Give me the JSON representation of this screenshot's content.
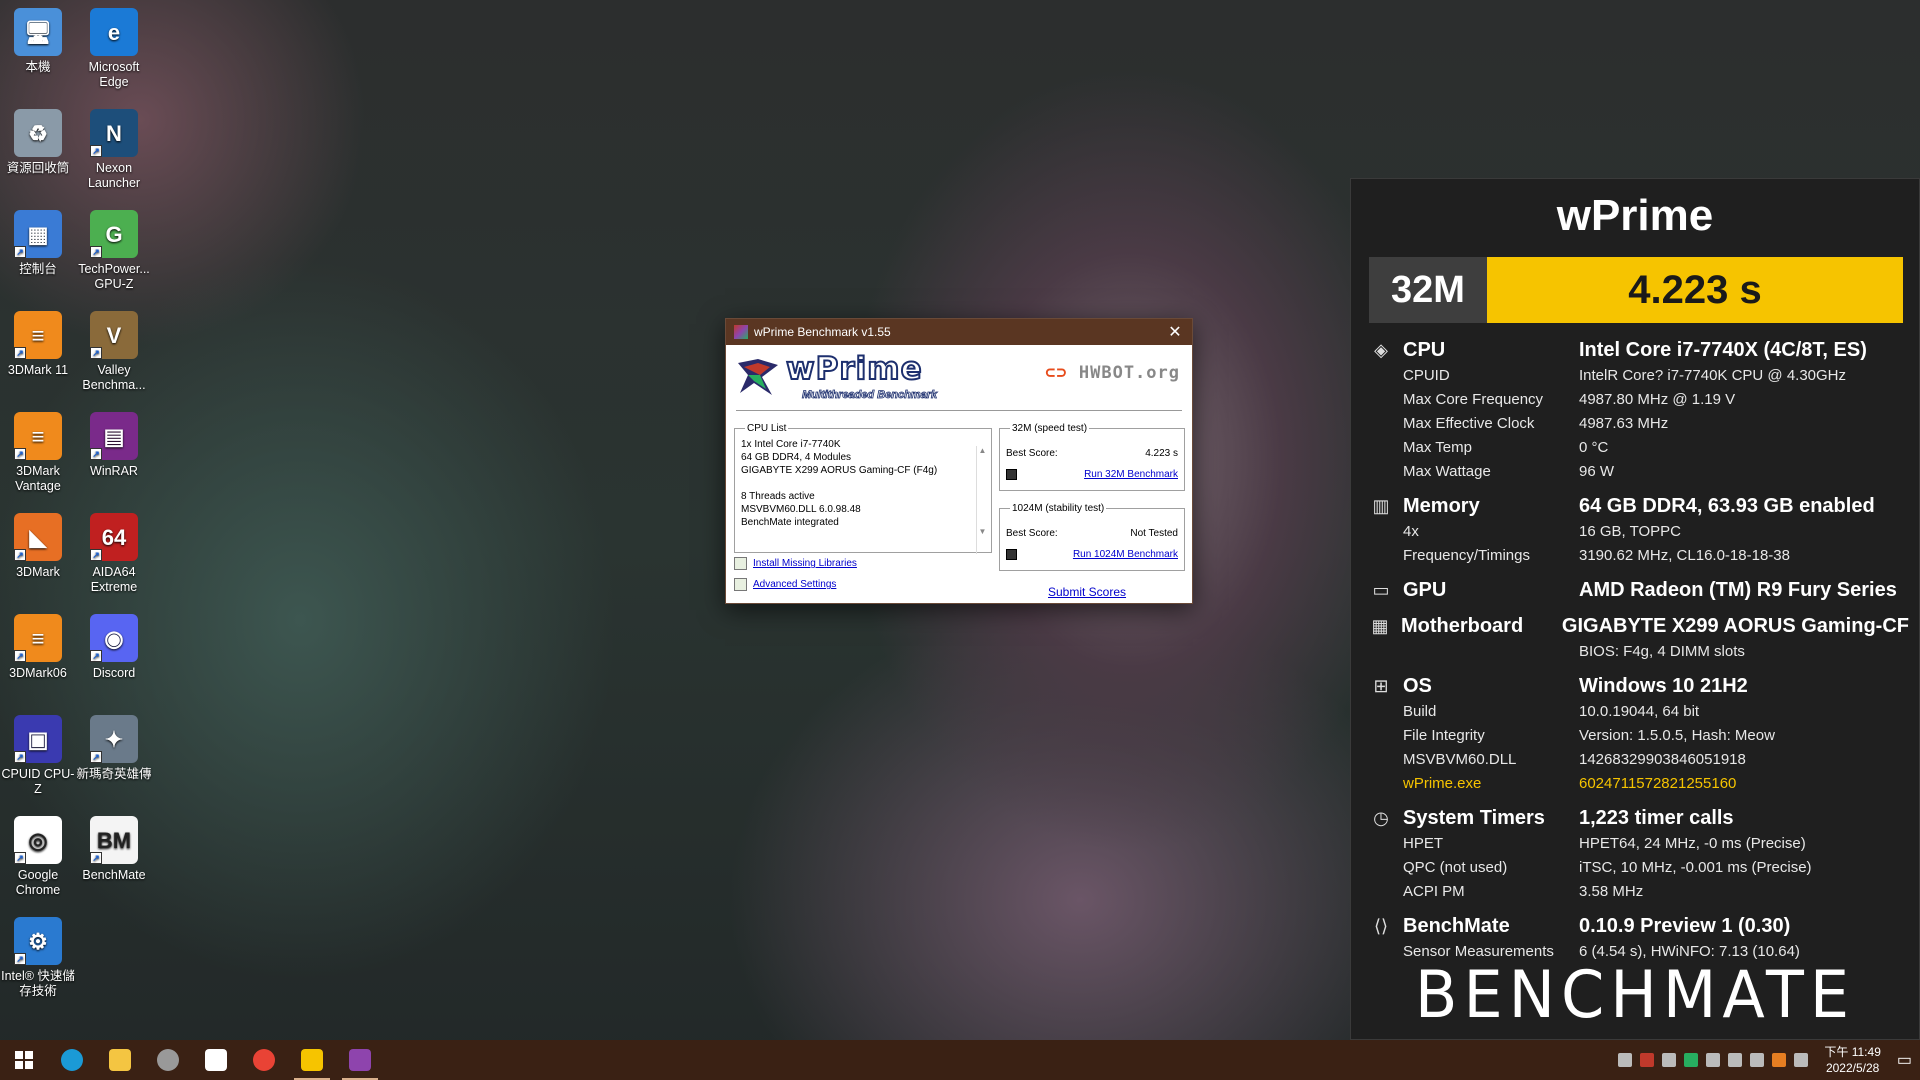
{
  "desktop": {
    "icons": [
      {
        "label": "本機",
        "icon": "computer-icon"
      },
      {
        "label": "Microsoft Edge",
        "icon": "edge-icon"
      },
      {
        "label": "資源回收筒",
        "icon": "recycle-bin-icon"
      },
      {
        "label": "Nexon Launcher",
        "icon": "nexon-icon"
      },
      {
        "label": "控制台",
        "icon": "control-panel-icon"
      },
      {
        "label": "TechPower... GPU-Z",
        "icon": "gpuz-icon"
      },
      {
        "label": "3DMark 11",
        "icon": "3dmark11-icon"
      },
      {
        "label": "Valley Benchma...",
        "icon": "valley-icon"
      },
      {
        "label": "3DMark Vantage",
        "icon": "3dmark-vantage-icon"
      },
      {
        "label": "WinRAR",
        "icon": "winrar-icon"
      },
      {
        "label": "3DMark",
        "icon": "3dmark-icon"
      },
      {
        "label": "AIDA64 Extreme",
        "icon": "aida64-icon"
      },
      {
        "label": "3DMark06",
        "icon": "3dmark06-icon"
      },
      {
        "label": "Discord",
        "icon": "discord-icon"
      },
      {
        "label": "CPUID CPU-Z",
        "icon": "cpuz-icon"
      },
      {
        "label": "新瑪奇英雄傳",
        "icon": "game-icon"
      },
      {
        "label": "Google Chrome",
        "icon": "chrome-icon"
      },
      {
        "label": "BenchMate",
        "icon": "benchmate-icon"
      },
      {
        "label": "Intel® 快速儲存技術",
        "icon": "intel-rst-icon"
      }
    ],
    "icon_glyphs": [
      "🖥",
      "e",
      "♻",
      "N",
      "▦",
      "G",
      "≡",
      "V",
      "≡",
      "▤",
      "◣",
      "64",
      "≡",
      "◉",
      "▣",
      "✦",
      "◎",
      "BM",
      "⚙"
    ],
    "icon_colors": [
      "#4a90d9",
      "#1b7ad6",
      "#8a9aa8",
      "#1d4e7a",
      "#3a7bd5",
      "#4caf50",
      "#f08a1c",
      "#8a6a3a",
      "#f08a1c",
      "#7a2a8a",
      "#e76f24",
      "#c02020",
      "#f08a1c",
      "#5865f2",
      "#3a3ab0",
      "#6a7a8a",
      "#ffffff",
      "#f4f4f4",
      "#2a7ad0"
    ]
  },
  "wprime_window": {
    "title": "wPrime Benchmark v1.55",
    "close_glyph": "✕",
    "logo": "wPrime",
    "logo_sub": "Multithreaded Benchmark",
    "hwbot": "HWBOT.org",
    "cpu_list": {
      "legend": "CPU List",
      "lines": [
        "1x Intel Core i7-7740K",
        "64 GB DDR4, 4 Modules",
        "GIGABYTE X299 AORUS Gaming-CF (F4g)",
        "",
        "8 Threads active",
        "MSVBVM60.DLL 6.0.98.48",
        "BenchMate integrated"
      ]
    },
    "test32": {
      "legend": "32M (speed test)",
      "best_label": "Best Score:",
      "best_value": "4.223 s",
      "run_label": "Run 32M Benchmark"
    },
    "test1024": {
      "legend": "1024M (stability test)",
      "best_label": "Best Score:",
      "best_value": "Not Tested",
      "run_label": "Run 1024M Benchmark"
    },
    "install_label": "Install Missing Libraries",
    "advanced_label": "Advanced Settings",
    "submit_label": "Submit Scores"
  },
  "benchmate": {
    "title": "wPrime",
    "score_label": "32M",
    "score_value": "4.223 s",
    "accent": "#f6c400",
    "sections": [
      {
        "icon": "cpu-icon",
        "glyph": "◈",
        "name": "CPU",
        "value": "Intel Core i7-7740X (4C/8T, ES)",
        "rows": [
          {
            "k": "CPUID",
            "v": "IntelR Core? i7-7740K CPU @ 4.30GHz"
          },
          {
            "k": "Max Core Frequency",
            "v": "4987.80 MHz @ 1.19 V"
          },
          {
            "k": "Max Effective Clock",
            "v": "4987.63 MHz"
          },
          {
            "k": "Max Temp",
            "v": "0 °C"
          },
          {
            "k": "Max Wattage",
            "v": "96 W"
          }
        ]
      },
      {
        "icon": "memory-icon",
        "glyph": "▥",
        "name": "Memory",
        "value": "64 GB DDR4, 63.93 GB enabled",
        "rows": [
          {
            "k": "4x",
            "v": "16 GB, TOPPC"
          },
          {
            "k": "Frequency/Timings",
            "v": "3190.62 MHz, CL16.0-18-18-38"
          }
        ]
      },
      {
        "icon": "gpu-icon",
        "glyph": "▭",
        "name": "GPU",
        "value": "AMD Radeon (TM) R9 Fury Series",
        "rows": []
      },
      {
        "icon": "motherboard-icon",
        "glyph": "▦",
        "name": "Motherboard",
        "value": "GIGABYTE X299 AORUS Gaming-CF",
        "rows": [
          {
            "k": "",
            "v": "BIOS: F4g, 4 DIMM slots"
          }
        ]
      },
      {
        "icon": "windows-icon",
        "glyph": "⊞",
        "name": "OS",
        "value": "Windows 10 21H2",
        "rows": [
          {
            "k": "Build",
            "v": "10.0.19044, 64 bit"
          },
          {
            "k": "File Integrity",
            "v": "Version: 1.5.0.5, Hash: Meow"
          },
          {
            "k": "MSVBVM60.DLL",
            "v": "14268329903846051918"
          },
          {
            "k": "wPrime.exe",
            "v": "6024711572821255160",
            "hl": true
          }
        ]
      },
      {
        "icon": "timer-icon",
        "glyph": "◷",
        "name": "System Timers",
        "value": "1,223 timer calls",
        "rows": [
          {
            "k": "HPET",
            "v": "HPET64, 24 MHz, -0 ms (Precise)"
          },
          {
            "k": "QPC (not used)",
            "v": "iTSC, 10 MHz, -0.001 ms (Precise)"
          },
          {
            "k": "ACPI PM",
            "v": "3.58 MHz"
          }
        ]
      },
      {
        "icon": "benchmate-icon",
        "glyph": "⟨⟩",
        "name": "BenchMate",
        "value": "0.10.9 Preview 1 (0.30)",
        "rows": [
          {
            "k": "Sensor Measurements",
            "v": "6 (4.54 s), HWiNFO: 7.13 (10.64)"
          }
        ]
      }
    ],
    "footer_logo": "BENCHMATE"
  },
  "taskbar": {
    "items": [
      {
        "icon": "start-icon",
        "color": "#ffffff"
      },
      {
        "icon": "edge-icon",
        "color": "#1b9ad6"
      },
      {
        "icon": "explorer-icon",
        "color": "#f4c542"
      },
      {
        "icon": "media-icon",
        "color": "#999999"
      },
      {
        "icon": "store-icon",
        "color": "#ffffff"
      },
      {
        "icon": "chrome-icon",
        "color": "#e94335"
      },
      {
        "icon": "benchmate-icon",
        "color": "#f6c400"
      },
      {
        "icon": "wprime-icon",
        "color": "#8e44ad"
      }
    ],
    "time": "下午 11:49",
    "date": "2022/5/28"
  }
}
